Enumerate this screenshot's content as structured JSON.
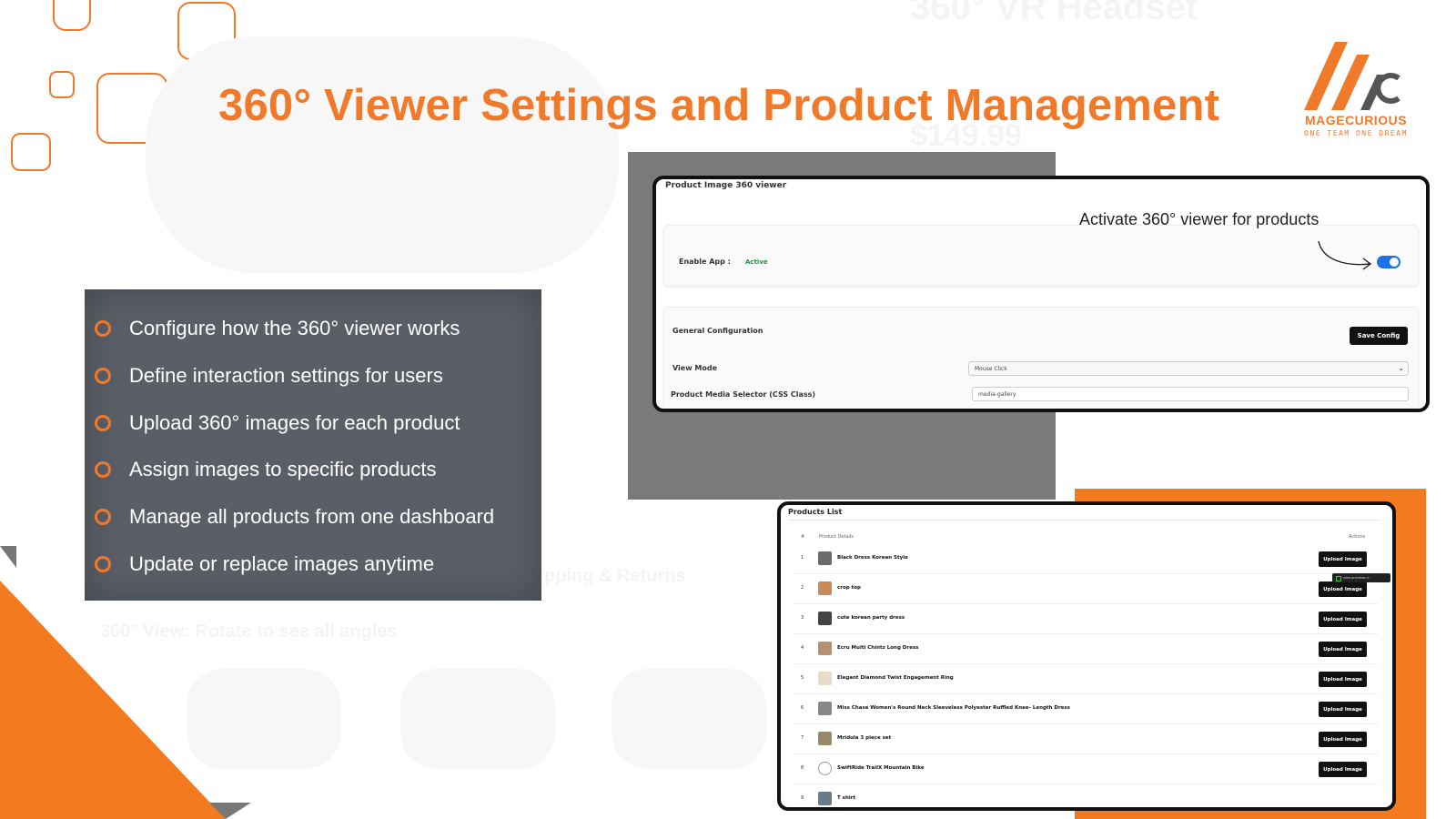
{
  "title": "360° Viewer Settings and Product Management",
  "logo": {
    "brand": "MAGECURIOUS",
    "tagline": "ONE TEAM ONE DREAM"
  },
  "watermark": {
    "heading": "360° VR Headset",
    "price": "$149.99",
    "caption": "360° View: Rotate to see all angles",
    "sub": "pping & Returns"
  },
  "features": [
    "Configure how the 360° viewer works",
    "Define interaction settings for users",
    "Upload 360° images for each product",
    "Assign images to specific products",
    "Manage all products from one dashboard",
    "Update or replace images anytime"
  ],
  "settings": {
    "header": "Product Image 360 viewer",
    "annotation": "Activate 360° viewer for products",
    "enable_label": "Enable App :",
    "enable_status": "Active",
    "general_label": "General Configuration",
    "save_label": "Save Config",
    "view_mode_label": "View Mode",
    "view_mode_value": "Mouse Click",
    "selector_label": "Product Media Selector (CSS Class)",
    "selector_value": "media-gallery"
  },
  "products": {
    "header": "Products List",
    "columns": {
      "num": "#",
      "details": "Product Details",
      "actions": "Actions"
    },
    "upload_label": "Upload Image",
    "toast": "view previews ⊙",
    "rows": [
      {
        "num": "1",
        "name": "Black Dress Korean Style"
      },
      {
        "num": "2",
        "name": "crop top"
      },
      {
        "num": "3",
        "name": "cute korean party dress"
      },
      {
        "num": "4",
        "name": "Ecru Multi Chintz Long Dress"
      },
      {
        "num": "5",
        "name": "Elegant Diamond Twist Engagement Ring"
      },
      {
        "num": "6",
        "name": "Miss Chase Women's Round Neck Sleeveless Polyester Ruffled Knee- Length Dress"
      },
      {
        "num": "7",
        "name": "Mridula 3 piece set"
      },
      {
        "num": "8",
        "name": "SwiftRide TrailX Mountain Bike"
      },
      {
        "num": "9",
        "name": "T shirt"
      }
    ]
  },
  "colors": {
    "accent": "#f07a2a",
    "panel": "#5a5e66",
    "toggle": "#1a73e8",
    "active": "#1a9a3a"
  }
}
